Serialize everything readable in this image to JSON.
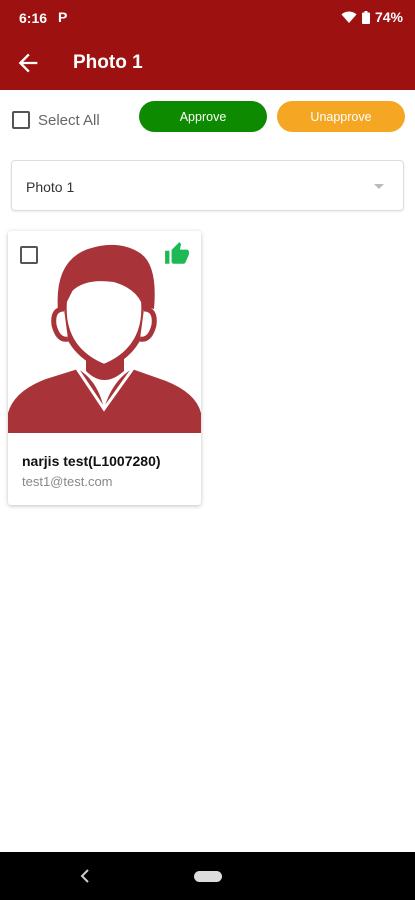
{
  "status_bar": {
    "time": "6:16",
    "app_indicator": "P",
    "battery": "74%",
    "icons": [
      "wifi-icon",
      "battery-icon"
    ]
  },
  "app_bar": {
    "title": "Photo 1",
    "back_icon": "arrow-left-icon"
  },
  "toolbar": {
    "select_all_label": "Select All",
    "approve_label": "Approve",
    "unapprove_label": "Unapprove"
  },
  "filter": {
    "selected": "Photo 1"
  },
  "cards": [
    {
      "name": "narjis test(L1007280)",
      "email": "test1@test.com",
      "status_icon": "thumbs-up-icon"
    }
  ],
  "colors": {
    "brand": "#9e1111",
    "approve": "#0d8a00",
    "unapprove": "#f5a623",
    "approved_status": "#1db954",
    "avatar": "#a8343a"
  }
}
